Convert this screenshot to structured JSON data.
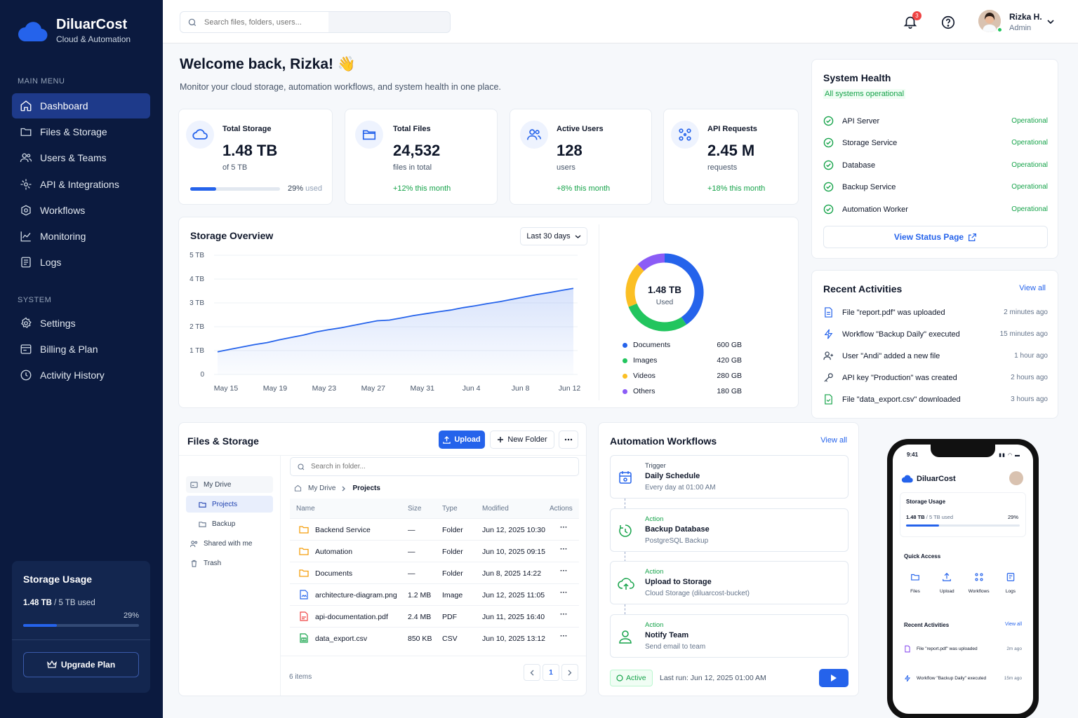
{
  "brand": {
    "name": "DiluarCost",
    "subtitle": "Cloud & Automation"
  },
  "sidebar": {
    "main_menu_title": "MAIN MENU",
    "main_items": [
      {
        "label": "Dashboard",
        "icon": "home-icon"
      },
      {
        "label": "Files & Storage",
        "icon": "folder-icon"
      },
      {
        "label": "Users & Teams",
        "icon": "users-icon"
      },
      {
        "label": "API & Integrations",
        "icon": "api-icon"
      },
      {
        "label": "Workflows",
        "icon": "workflow-icon"
      },
      {
        "label": "Monitoring",
        "icon": "chart-icon"
      },
      {
        "label": "Logs",
        "icon": "logs-icon"
      }
    ],
    "system_title": "SYSTEM",
    "system_items": [
      {
        "label": "Settings",
        "icon": "gear-icon"
      },
      {
        "label": "Billing & Plan",
        "icon": "billing-icon"
      },
      {
        "label": "Activity History",
        "icon": "history-icon"
      }
    ],
    "storage": {
      "title": "Storage Usage",
      "used": "1.48 TB",
      "total": "/ 5 TB used",
      "percent": "29%",
      "fraction": 0.29,
      "upgrade_label": "Upgrade Plan"
    }
  },
  "header": {
    "search_placeholder": "Search files, folders, users...",
    "notifications": "3",
    "user_name": "Rizka H.",
    "user_role": "Admin"
  },
  "welcome": {
    "title": "Welcome back, Rizka! 👋",
    "subtitle": "Monitor your cloud storage, automation workflows, and system health in one place."
  },
  "stats": [
    {
      "label": "Total Storage",
      "value": "1.48 TB",
      "unit": "of 5 TB",
      "percent": "29%",
      "percent_suffix": "used",
      "fraction": 0.29
    },
    {
      "label": "Total Files",
      "value": "24,532",
      "unit": "files in total",
      "change": "+12% this month"
    },
    {
      "label": "Active Users",
      "value": "128",
      "unit": "users",
      "change": "+8% this month"
    },
    {
      "label": "API Requests",
      "value": "2.45 M",
      "unit": "requests",
      "change": "+18% this month"
    }
  ],
  "storage_overview": {
    "title": "Storage Overview",
    "range": "Last 30 days",
    "donut_value": "1.48 TB",
    "donut_label": "Used",
    "legend": [
      {
        "name": "Documents",
        "value": "600 GB",
        "color": "#2563eb"
      },
      {
        "name": "Images",
        "value": "420 GB",
        "color": "#22c55e"
      },
      {
        "name": "Videos",
        "value": "280 GB",
        "color": "#fbbf24"
      },
      {
        "name": "Others",
        "value": "180 GB",
        "color": "#8b5cf6"
      }
    ]
  },
  "chart_data": {
    "type": "area",
    "title": "Storage Overview",
    "x": [
      "May 15",
      "May 16",
      "May 17",
      "May 18",
      "May 19",
      "May 20",
      "May 21",
      "May 22",
      "May 23",
      "May 24",
      "May 25",
      "May 26",
      "May 27",
      "May 28",
      "May 29",
      "May 30",
      "May 31",
      "Jun 1",
      "Jun 2",
      "Jun 3",
      "Jun 4",
      "Jun 5",
      "Jun 6",
      "Jun 7",
      "Jun 8",
      "Jun 9",
      "Jun 10",
      "Jun 11",
      "Jun 12",
      "Jun 13"
    ],
    "x_ticks": [
      "May 15",
      "May 19",
      "May 23",
      "May 27",
      "May 31",
      "Jun 4",
      "Jun 8",
      "Jun 12"
    ],
    "series": [
      {
        "values": [
          0.95,
          1.05,
          1.15,
          1.25,
          1.33,
          1.45,
          1.55,
          1.65,
          1.78,
          1.87,
          1.95,
          2.05,
          2.15,
          2.25,
          2.28,
          2.37,
          2.47,
          2.55,
          2.63,
          2.7,
          2.8,
          2.88,
          2.97,
          3.05,
          3.15,
          3.25,
          3.35,
          3.43,
          3.52,
          3.61
        ]
      }
    ],
    "y_ticks": [
      "0",
      "1 TB",
      "2 TB",
      "3 TB",
      "4 TB",
      "5 TB"
    ],
    "ylim": [
      0,
      5
    ],
    "grid": true,
    "pie": [
      {
        "name": "Documents",
        "value": 600
      },
      {
        "name": "Images",
        "value": 420
      },
      {
        "name": "Videos",
        "value": 280
      },
      {
        "name": "Others",
        "value": 180
      }
    ]
  },
  "system_health": {
    "title": "System Health",
    "summary": "All systems operational",
    "services": [
      {
        "name": "API Server",
        "status": "Operational"
      },
      {
        "name": "Storage Service",
        "status": "Operational"
      },
      {
        "name": "Database",
        "status": "Operational"
      },
      {
        "name": "Backup Service",
        "status": "Operational"
      },
      {
        "name": "Automation Worker",
        "status": "Operational"
      }
    ],
    "button": "View Status Page"
  },
  "recent_activities": {
    "title": "Recent Activities",
    "view_all": "View all",
    "items": [
      {
        "text": "File \"report.pdf\" was uploaded",
        "time": "2 minutes ago",
        "icon": "file-icon"
      },
      {
        "text": "Workflow \"Backup Daily\" executed",
        "time": "15 minutes ago",
        "icon": "bolt-icon"
      },
      {
        "text": "User \"Andi\" added a new file",
        "time": "1 hour ago",
        "icon": "user-icon"
      },
      {
        "text": "API key \"Production\" was created",
        "time": "2 hours ago",
        "icon": "key-icon"
      },
      {
        "text": "File \"data_export.csv\" downloaded",
        "time": "3 hours ago",
        "icon": "file-csv-icon"
      }
    ]
  },
  "files": {
    "title": "Files & Storage",
    "upload": "Upload",
    "new_folder": "New Folder",
    "search_placeholder": "Search in folder...",
    "tree": [
      {
        "label": "My Drive"
      },
      {
        "label": "Projects"
      },
      {
        "label": "Backup"
      },
      {
        "label": "Shared with me"
      },
      {
        "label": "Trash"
      }
    ],
    "breadcrumb": {
      "root": "My Drive",
      "current": "Projects"
    },
    "columns": [
      "Name",
      "Size",
      "Type",
      "Modified",
      "Actions"
    ],
    "rows": [
      {
        "name": "Backend Service",
        "size": "—",
        "type": "Folder",
        "modified": "Jun 12, 2025 10:30"
      },
      {
        "name": "Automation",
        "size": "—",
        "type": "Folder",
        "modified": "Jun 10, 2025 09:15"
      },
      {
        "name": "Documents",
        "size": "—",
        "type": "Folder",
        "modified": "Jun 8, 2025 14:22"
      },
      {
        "name": "architecture-diagram.png",
        "size": "1.2 MB",
        "type": "Image",
        "modified": "Jun 12, 2025 11:05"
      },
      {
        "name": "api-documentation.pdf",
        "size": "2.4 MB",
        "type": "PDF",
        "modified": "Jun 11, 2025 16:40"
      },
      {
        "name": "data_export.csv",
        "size": "850 KB",
        "type": "CSV",
        "modified": "Jun 10, 2025 13:12"
      }
    ],
    "items_count": "6 items",
    "page": "1"
  },
  "workflows": {
    "title": "Automation Workflows",
    "view_all": "View all",
    "steps": [
      {
        "kind": "Trigger",
        "title": "Daily Schedule",
        "sub": "Every day at 01:00 AM"
      },
      {
        "kind": "Action",
        "title": "Backup Database",
        "sub": "PostgreSQL Backup"
      },
      {
        "kind": "Action",
        "title": "Upload to Storage",
        "sub": "Cloud Storage (diluarcost-bucket)"
      },
      {
        "kind": "Action",
        "title": "Notify Team",
        "sub": "Send email to team"
      }
    ],
    "status": "Active",
    "last_run": "Last run: Jun 12, 2025 01:00 AM"
  },
  "phone": {
    "time": "9:41",
    "brand": "DiluarCost",
    "storage_title": "Storage Usage",
    "storage_used": "1.48 TB",
    "storage_total": "/ 5 TB used",
    "storage_pct": "29%",
    "quick_title": "Quick Access",
    "quick": [
      "Files",
      "Upload",
      "Workflows",
      "Logs"
    ],
    "recent_title": "Recent Activities",
    "view_all": "View all",
    "recent": [
      {
        "text": "File \"report.pdf\" was uploaded",
        "time": "2m ago"
      },
      {
        "text": "Workflow \"Backup Daily\" executed",
        "time": "15m ago"
      }
    ]
  }
}
